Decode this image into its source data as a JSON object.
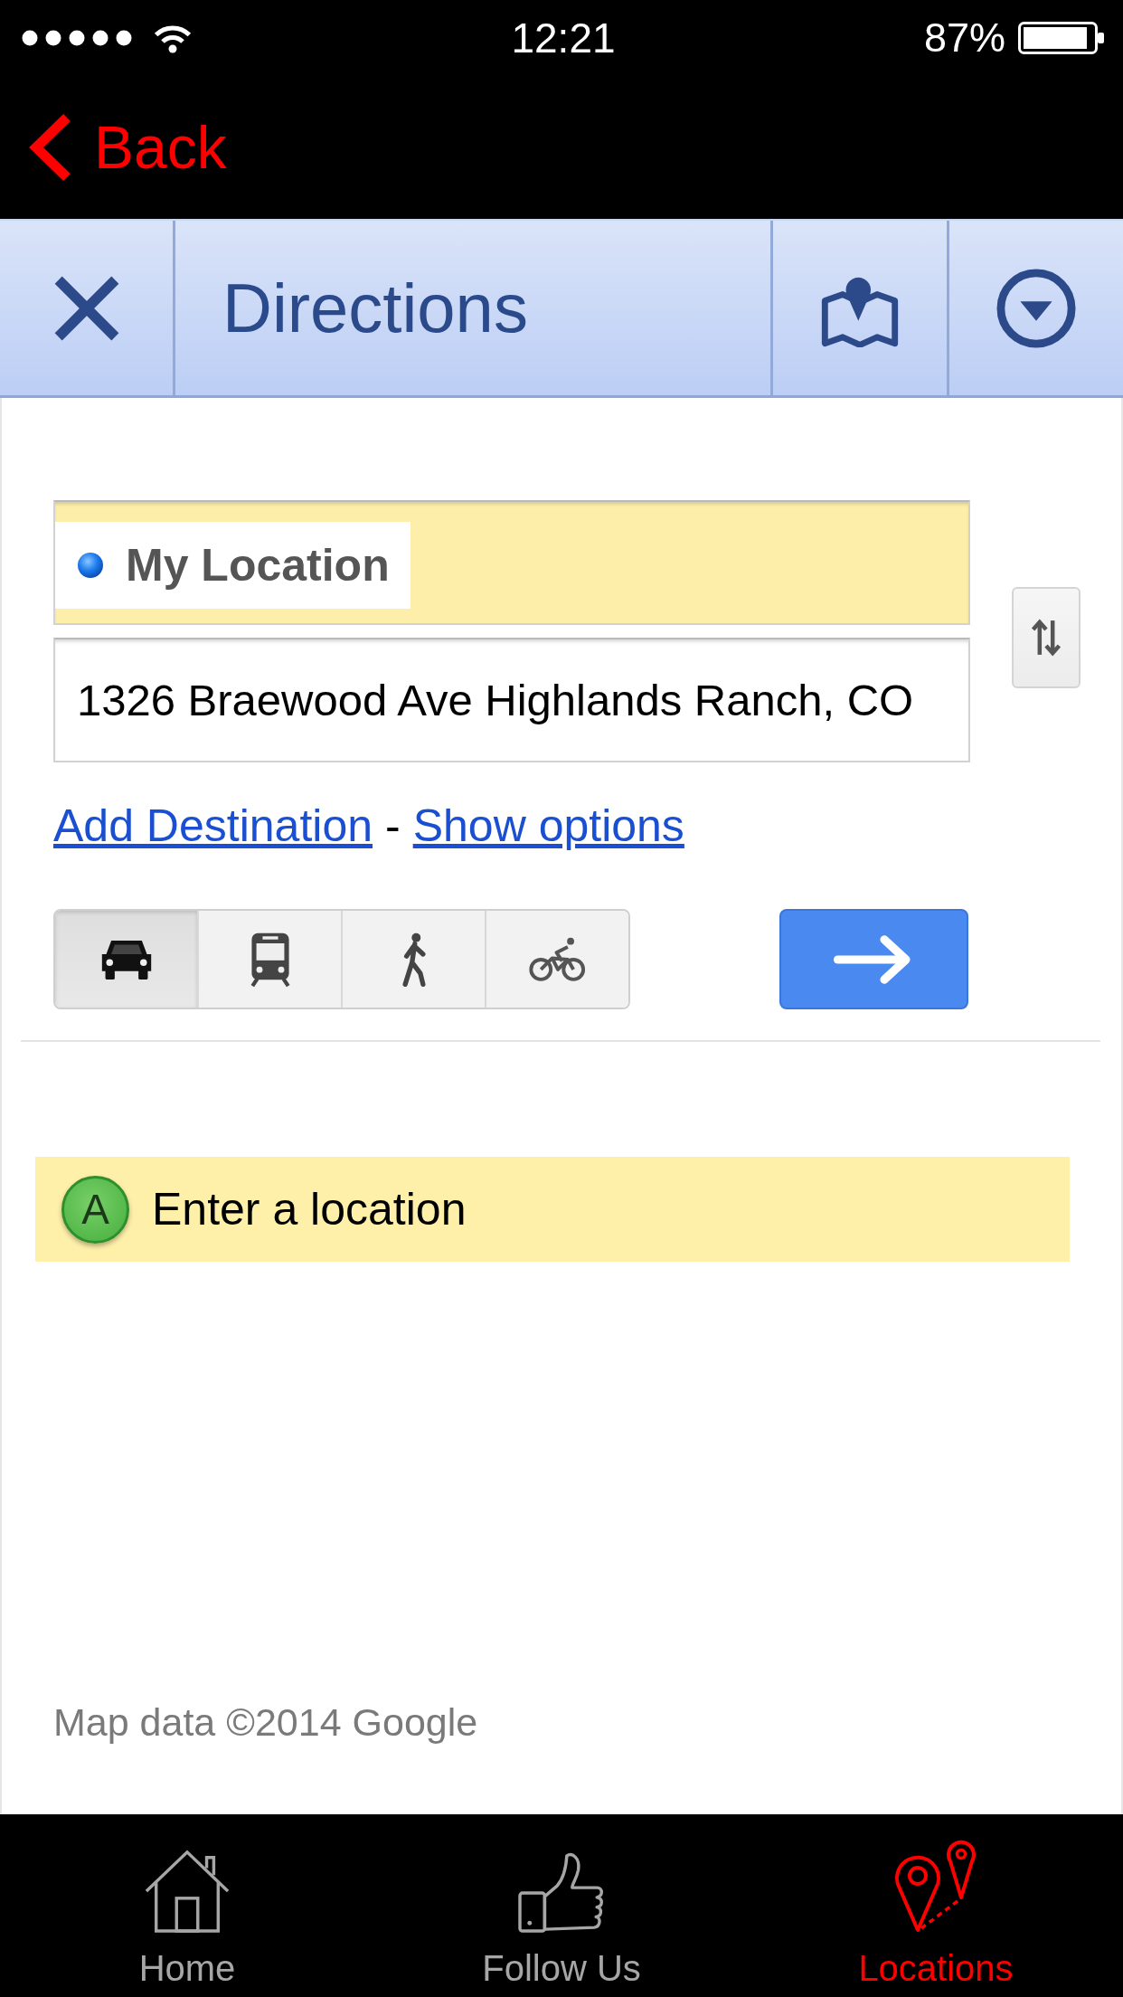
{
  "status_bar": {
    "time": "12:21",
    "battery": "87%"
  },
  "nav_bar": {
    "back_label": "Back"
  },
  "header": {
    "title": "Directions"
  },
  "route": {
    "waypoints": [
      {
        "kind": "current",
        "value": "My Location",
        "active": true
      },
      {
        "kind": "address",
        "value": "1326 Braewood Ave Highlands Ranch, CO",
        "active": false
      }
    ],
    "links": [
      "Add Destination",
      "Show options"
    ],
    "separator": "-"
  },
  "travel_modes": [
    {
      "kind": "car",
      "selected": true
    },
    {
      "kind": "transit",
      "selected": false
    },
    {
      "kind": "walk",
      "selected": false
    },
    {
      "kind": "bike",
      "selected": false
    }
  ],
  "suggestion": {
    "marker": "A",
    "text": "Enter a location"
  },
  "attribution": "Map data ©2014 Google",
  "tab_bar": {
    "items": [
      {
        "kind": "home",
        "label": "Home",
        "selected": false
      },
      {
        "kind": "like",
        "label": "Follow Us",
        "selected": false
      },
      {
        "kind": "locations",
        "label": "Locations",
        "selected": true
      }
    ]
  }
}
